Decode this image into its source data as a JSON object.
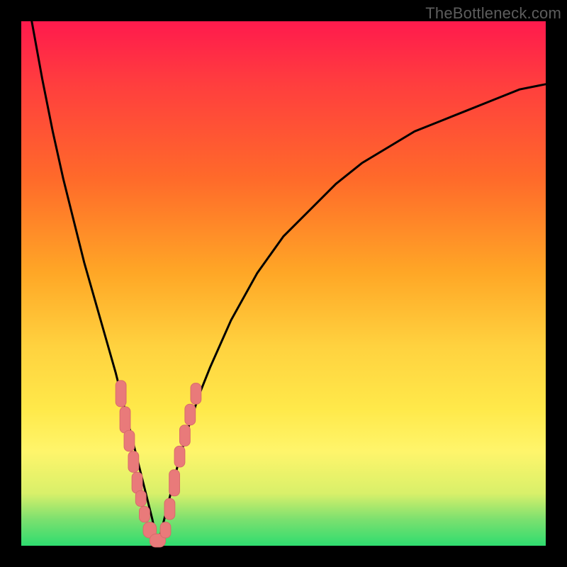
{
  "watermark": "TheBottleneck.com",
  "colors": {
    "frame": "#000000",
    "curve": "#000000",
    "marker_fill": "#e97a7a",
    "marker_stroke": "#d86b6b"
  },
  "chart_data": {
    "type": "line",
    "title": "",
    "xlabel": "",
    "ylabel": "",
    "xlim": [
      0,
      100
    ],
    "ylim": [
      0,
      100
    ],
    "grid": false,
    "series": [
      {
        "name": "left-branch",
        "note": "Curve descending from top-left toward the V apex",
        "x": [
          2,
          4,
          6,
          8,
          10,
          12,
          14,
          16,
          18,
          20,
          21,
          22,
          23,
          24,
          25,
          26
        ],
        "y": [
          100,
          89,
          79,
          70,
          62,
          54,
          47,
          40,
          33,
          25,
          21,
          17,
          13,
          9,
          5,
          0
        ]
      },
      {
        "name": "right-branch",
        "note": "Curve rising from the V apex toward upper right; asymptotically flattening",
        "x": [
          26,
          28,
          30,
          32,
          34,
          36,
          40,
          45,
          50,
          55,
          60,
          65,
          70,
          75,
          80,
          85,
          90,
          95,
          100
        ],
        "y": [
          0,
          8,
          16,
          23,
          29,
          34,
          43,
          52,
          59,
          64,
          69,
          73,
          76,
          79,
          81,
          83,
          85,
          87,
          88
        ]
      }
    ],
    "markers": {
      "note": "Pink rounded-rect markers clustered near the bottom of the V on both branches",
      "points": [
        {
          "x": 19.0,
          "y": 29,
          "w": 2.0,
          "h": 5
        },
        {
          "x": 19.8,
          "y": 24,
          "w": 2.0,
          "h": 5
        },
        {
          "x": 20.6,
          "y": 20,
          "w": 2.0,
          "h": 4
        },
        {
          "x": 21.4,
          "y": 16,
          "w": 2.0,
          "h": 4
        },
        {
          "x": 22.1,
          "y": 12,
          "w": 2.0,
          "h": 4
        },
        {
          "x": 22.8,
          "y": 9,
          "w": 2.0,
          "h": 3
        },
        {
          "x": 23.5,
          "y": 6,
          "w": 2.0,
          "h": 3
        },
        {
          "x": 24.5,
          "y": 3,
          "w": 2.5,
          "h": 3
        },
        {
          "x": 26.0,
          "y": 1,
          "w": 3.0,
          "h": 2.5
        },
        {
          "x": 27.5,
          "y": 3,
          "w": 2.0,
          "h": 3
        },
        {
          "x": 28.3,
          "y": 7,
          "w": 2.0,
          "h": 4
        },
        {
          "x": 29.2,
          "y": 12,
          "w": 2.0,
          "h": 5
        },
        {
          "x": 30.2,
          "y": 17,
          "w": 2.0,
          "h": 4
        },
        {
          "x": 31.2,
          "y": 21,
          "w": 2.0,
          "h": 4
        },
        {
          "x": 32.2,
          "y": 25,
          "w": 2.0,
          "h": 4
        },
        {
          "x": 33.3,
          "y": 29,
          "w": 2.0,
          "h": 4
        }
      ]
    }
  }
}
